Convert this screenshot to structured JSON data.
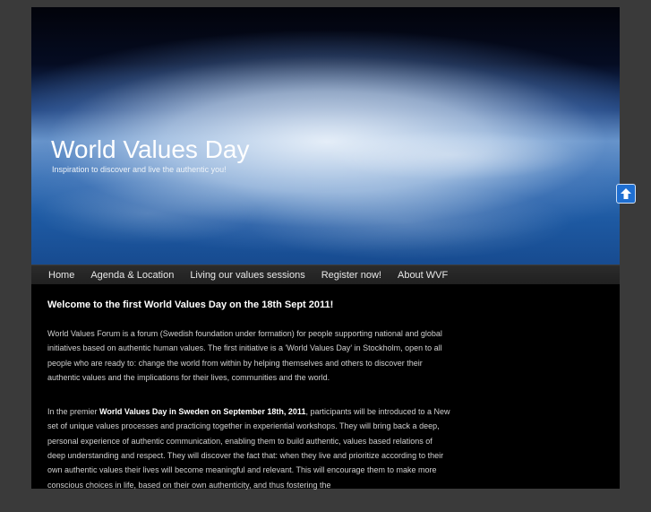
{
  "site": {
    "title": "World Values Day",
    "tagline": "Inspiration to discover and live the authentic you!"
  },
  "nav": {
    "items": [
      {
        "label": "Home"
      },
      {
        "label": "Agenda & Location"
      },
      {
        "label": "Living our values sessions"
      },
      {
        "label": "Register now!"
      },
      {
        "label": "About WVF"
      }
    ]
  },
  "article": {
    "heading": "Welcome to the first World Values Day on the 18th Sept 2011!",
    "para1": "World Values Forum is a forum (Swedish foundation under formation) for people supporting national and global initiatives based on authentic human values. The first initiative is a 'World Values Day' in Stockholm, open to all people who are ready to: change the world from within by helping themselves and others to discover their authentic values and the implications for their lives, communities and the world.",
    "para2_prefix": "In the premier ",
    "para2_bold": "World Values Day in Sweden on September 18th, 2011",
    "para2_suffix": ", participants will be introduced to a New set of unique values processes and practicing together in experiential workshops. They will bring back a deep, personal experience of authentic communication, enabling them to build authentic, values based relations of deep understanding and respect. They will discover the fact that: when they live and prioritize according to their own authentic values their lives will become meaningful and relevant. This will encourage them to make more conscious choices in life, based on their own authenticity, and thus fostering the"
  },
  "scroll_top": {
    "icon": "arrow-up-icon"
  },
  "colors": {
    "background": "#3a3a3a",
    "page": "#000000",
    "nav": "#252525",
    "accent": "#1f6fd1"
  }
}
